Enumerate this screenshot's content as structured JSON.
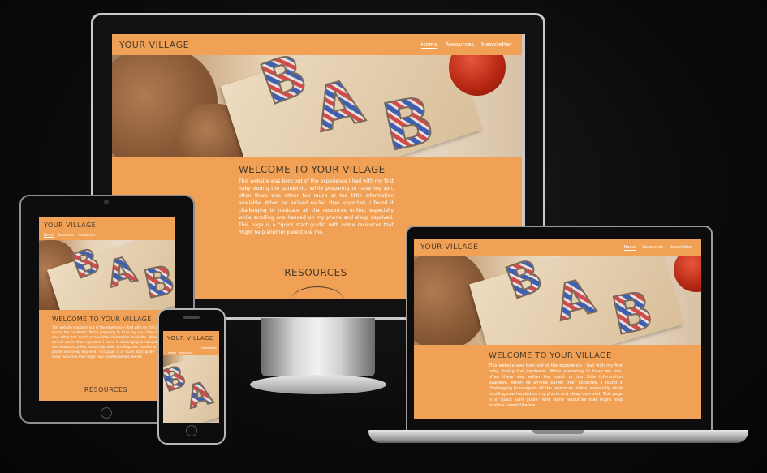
{
  "site": {
    "brand": "YOUR VILLAGE",
    "nav": [
      "Home",
      "Resources",
      "Newsletter"
    ],
    "hero_letters": [
      "B",
      "A",
      "B"
    ],
    "welcome_title": "WELCOME TO YOUR VILLAGE",
    "intro": "This website was born out of the experience I had with my first baby during the pandemic. While preparing to have my son, often there was either too much or too little information available. When he arrived earlier than expected, I found it challenging to navigate all the resources online, especially while scrolling one handed on my phone and sleep deprived. This page is a \"quick start guide\" with some resources that might help another parent like me.",
    "resources_title": "RESOURCES"
  },
  "colors": {
    "accent": "#f0a155",
    "heading": "#4a3a2a",
    "body_text": "#ffffff",
    "background": "#0b0b0b"
  }
}
